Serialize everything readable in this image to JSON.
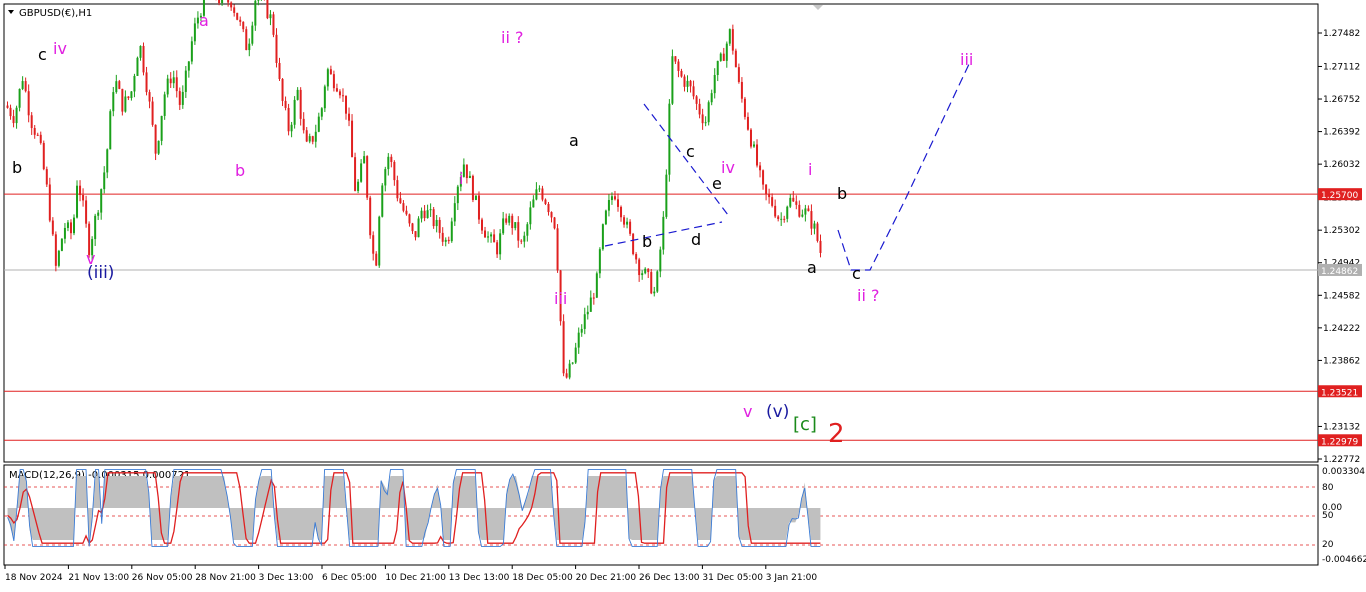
{
  "window": {
    "symbol_title": "GBPUSD(€),H1"
  },
  "chart_data": [
    {
      "type": "line",
      "title": "GBPUSD(€),H1",
      "x_tick_labels": [
        "18 Nov 2024",
        "21 Nov 13:00",
        "26 Nov 05:00",
        "28 Nov 21:00",
        "3 Dec 13:00",
        "6 Dec 05:00",
        "10 Dec 21:00",
        "13 Dec 13:00",
        "18 Dec 05:00",
        "20 Dec 21:00",
        "26 Dec 13:00",
        "31 Dec 05:00",
        "3 Jan 21:00"
      ],
      "y_tick_labels": [
        "1.27482",
        "1.27112",
        "1.26752",
        "1.26392",
        "1.26032",
        "1.25662",
        "1.25302",
        "1.24942",
        "1.24582",
        "1.24222",
        "1.23862",
        "1.23492",
        "1.23132",
        "1.22772"
      ],
      "ylim": [
        1.225,
        1.2785
      ],
      "series": [
        {
          "x": [
            0,
            4,
            8,
            12,
            16,
            20,
            24,
            28,
            32,
            34,
            36,
            40,
            44,
            48,
            52,
            56,
            60,
            64,
            68,
            72,
            76,
            80,
            84,
            88,
            90,
            92,
            96,
            100,
            104,
            108,
            112,
            116,
            120,
            124,
            128,
            132,
            136,
            140,
            144,
            148,
            152,
            154,
            156,
            160,
            164,
            168,
            172,
            176,
            178,
            180,
            184,
            188,
            192,
            196,
            200,
            204,
            208,
            212,
            216,
            220,
            224,
            228,
            232,
            236,
            240,
            244,
            248,
            252,
            256,
            260,
            264,
            268,
            272,
            276,
            280,
            284,
            286,
            288,
            292,
            296,
            300,
            304,
            308,
            312,
            316,
            320,
            324,
            328,
            330,
            332,
            336,
            340,
            344,
            348,
            350,
            352,
            356,
            360,
            364,
            368,
            372,
            376,
            380,
            384,
            388,
            392
          ],
          "close": [
            1.2668,
            1.2655,
            1.27,
            1.2652,
            1.2628,
            1.257,
            1.2488,
            1.2535,
            1.2525,
            1.2585,
            1.257,
            1.251,
            1.2555,
            1.2605,
            1.27,
            1.2668,
            1.268,
            1.274,
            1.2685,
            1.2615,
            1.268,
            1.2705,
            1.2665,
            1.272,
            1.2748,
            1.2765,
            1.279,
            1.2795,
            1.278,
            1.2785,
            1.276,
            1.273,
            1.279,
            1.278,
            1.276,
            1.268,
            1.264,
            1.2685,
            1.262,
            1.2635,
            1.2668,
            1.271,
            1.27,
            1.269,
            1.266,
            1.257,
            1.261,
            1.2505,
            1.2498,
            1.258,
            1.2615,
            1.257,
            1.2545,
            1.252,
            1.2555,
            1.2545,
            1.253,
            1.2515,
            1.2575,
            1.2605,
            1.2575,
            1.254,
            1.252,
            1.251,
            1.2545,
            1.2535,
            1.251,
            1.2552,
            1.2578,
            1.256,
            1.2535,
            1.236,
            1.2382,
            1.242,
            1.2445,
            1.2475,
            1.252,
            1.2545,
            1.2575,
            1.255,
            1.252,
            1.249,
            1.2478,
            1.2458,
            1.2545,
            1.272,
            1.27,
            1.269,
            1.268,
            1.2667,
            1.265,
            1.27,
            1.272,
            1.275,
            1.272,
            1.269,
            1.265,
            1.261,
            1.257,
            1.256,
            1.254,
            1.2565,
            1.2555,
            1.255,
            1.2535,
            1.25
          ]
        }
      ],
      "horizontal_lines": [
        {
          "label": "1.25700",
          "value": 1.257,
          "color": "#e02020"
        },
        {
          "label": "1.24862",
          "value": 1.24862,
          "color": "#b0b0b0"
        },
        {
          "label": "1.23521",
          "value": 1.23521,
          "color": "#e02020"
        },
        {
          "label": "1.22979",
          "value": 1.22979,
          "color": "#e02020"
        }
      ],
      "wave_labels": [
        {
          "text": "c",
          "color": "#000000"
        },
        {
          "text": "iv",
          "color": "#e020e0"
        },
        {
          "text": "b",
          "color": "#000000"
        },
        {
          "text": "v",
          "color": "#e020e0"
        },
        {
          "text": "(iii)",
          "color": "#1a1aa0"
        },
        {
          "text": "a",
          "color": "#e020e0"
        },
        {
          "text": "b",
          "color": "#e020e0"
        },
        {
          "text": "ii ?",
          "color": "#e020e0"
        },
        {
          "text": "i",
          "color": "#e020e0"
        },
        {
          "text": "iii",
          "color": "#e020e0"
        },
        {
          "text": "a",
          "color": "#000000"
        },
        {
          "text": "c",
          "color": "#000000"
        },
        {
          "text": "e",
          "color": "#000000"
        },
        {
          "text": "iv",
          "color": "#e020e0"
        },
        {
          "text": "b",
          "color": "#000000"
        },
        {
          "text": "d",
          "color": "#000000"
        },
        {
          "text": "v",
          "color": "#e020e0"
        },
        {
          "text": "(v)",
          "color": "#1a1aa0"
        },
        {
          "text": "[c]",
          "color": "#1a8a1a"
        },
        {
          "text": "2",
          "color": "#e02020"
        },
        {
          "text": "i",
          "color": "#e020e0"
        },
        {
          "text": "b",
          "color": "#000000"
        },
        {
          "text": "a",
          "color": "#000000"
        },
        {
          "text": "c",
          "color": "#000000"
        },
        {
          "text": "ii ?",
          "color": "#e020e0"
        },
        {
          "text": "iii",
          "color": "#e020e0"
        }
      ]
    },
    {
      "type": "area",
      "title": "MACD(12,26,9) -0.000315 0.000721",
      "y_tick_labels": [
        "0.003304",
        "80",
        "0.00",
        "50",
        "20",
        "-0.004662"
      ],
      "ylim": [
        -0.004662,
        0.003304
      ],
      "reference_levels": [
        80,
        50,
        20
      ],
      "series": [
        {
          "name": "MACD",
          "color": "#c0c0c0"
        },
        {
          "name": "Signal",
          "color": "#e02020"
        },
        {
          "name": "Oscillator",
          "color": "#3a7bd5"
        }
      ]
    }
  ],
  "colors": {
    "bull_candle": "#1aa01a",
    "bear_candle": "#e02020",
    "projection_line": "#1a1ad0",
    "grid_red": "#e02020"
  }
}
